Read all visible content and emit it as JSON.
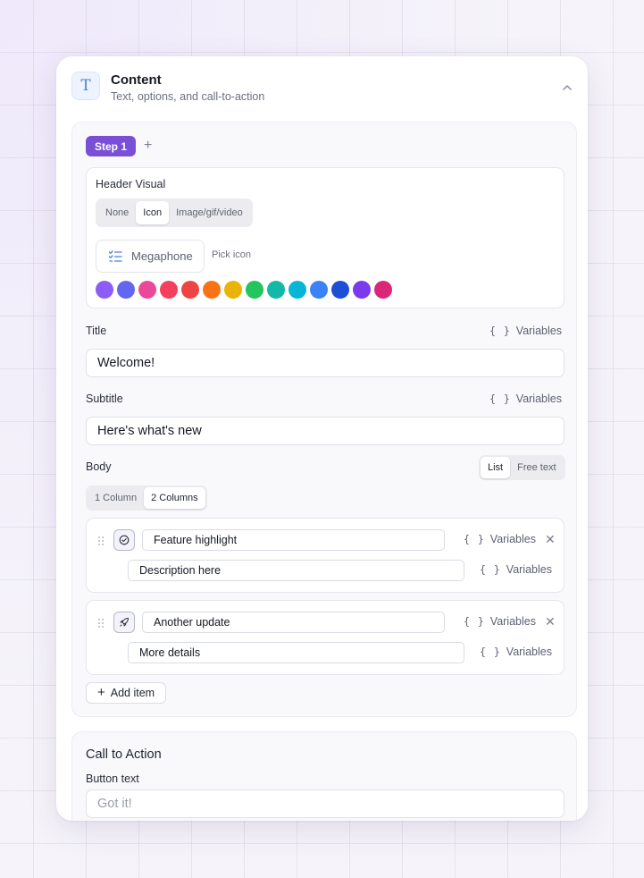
{
  "header": {
    "icon_glyph": "T",
    "title": "Content",
    "subtitle": "Text, options, and call-to-action",
    "collapse_icon": "chevron-up-icon"
  },
  "steps": {
    "active_label": "Step 1",
    "add_label": "+"
  },
  "header_visual": {
    "label": "Header Visual",
    "options": [
      "None",
      "Icon",
      "Image/gif/video"
    ],
    "selected": "Icon",
    "icon_name": "Megaphone",
    "pick_label": "Pick icon",
    "swatches": [
      "#8b5cf6",
      "#6366f1",
      "#ec4899",
      "#f43f5e",
      "#ef4444",
      "#f97316",
      "#eab308",
      "#22c55e",
      "#14b8a6",
      "#06b6d4",
      "#3b82f6",
      "#1d4ed8",
      "#7c3aed",
      "#db2777"
    ]
  },
  "variables_label": "Variables",
  "variables_braces": "{ }",
  "title_field": {
    "label": "Title",
    "value": "Welcome!"
  },
  "subtitle_field": {
    "label": "Subtitle",
    "value": "Here's what's new"
  },
  "body": {
    "label": "Body",
    "modes": [
      "List",
      "Free text"
    ],
    "selected_mode": "List",
    "columns": [
      "1 Column",
      "2 Columns"
    ],
    "selected_columns": "2 Columns",
    "items": [
      {
        "icon": "check-circle-icon",
        "title": "Feature highlight",
        "description": "Description here"
      },
      {
        "icon": "rocket-icon",
        "title": "Another update",
        "description": "More details"
      }
    ],
    "add_label": "Add item"
  },
  "cta": {
    "title": "Call to Action",
    "button_label": "Button text",
    "button_placeholder": "Got it!"
  },
  "colors": {
    "accent": "#7a4fd8",
    "icon_blue": "#4d7fd6"
  }
}
